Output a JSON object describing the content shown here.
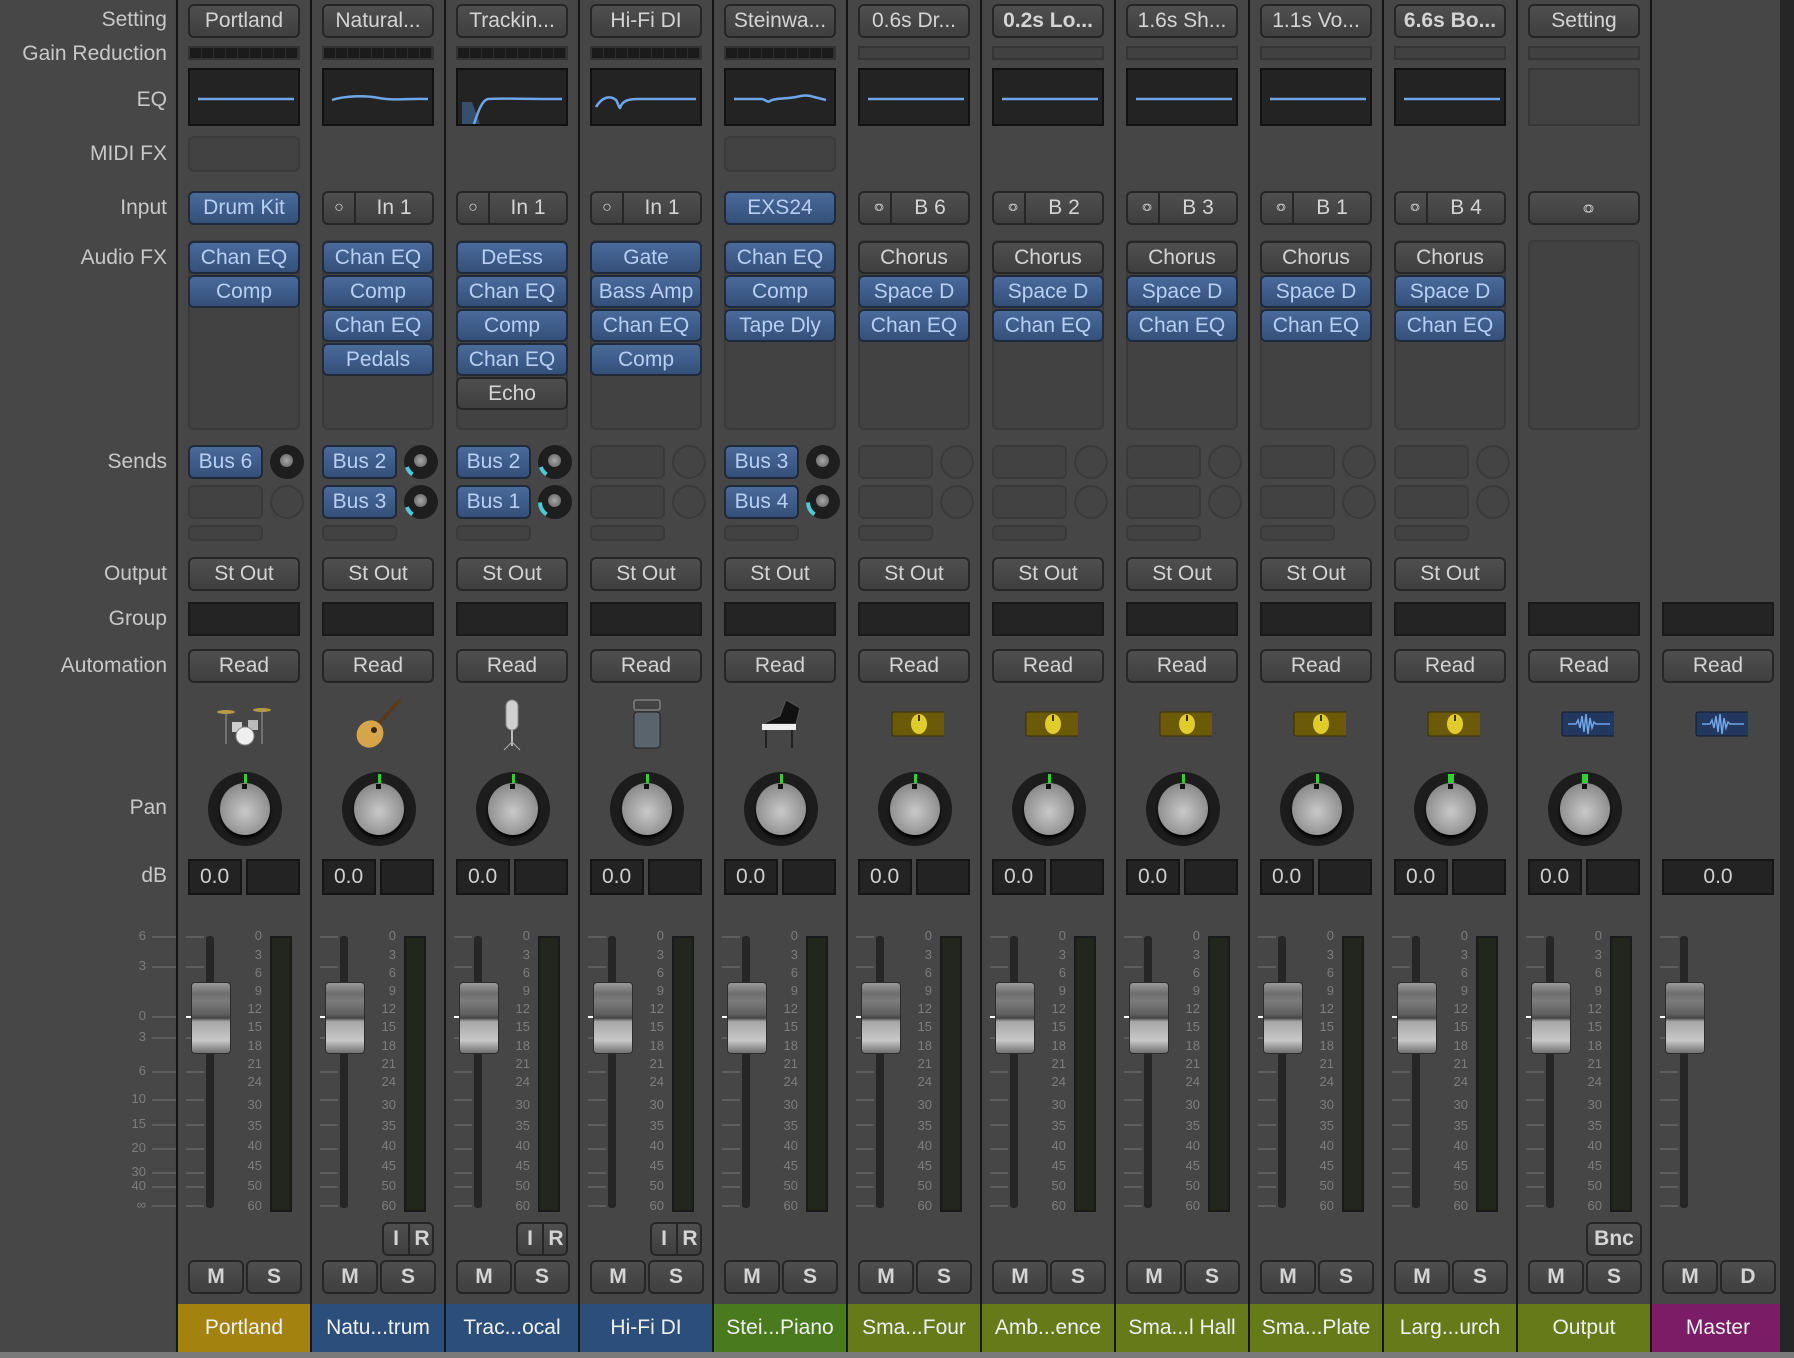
{
  "row_labels": {
    "setting": "Setting",
    "gain_reduction": "Gain Reduction",
    "eq": "EQ",
    "midi_fx": "MIDI FX",
    "input": "Input",
    "audio_fx": "Audio FX",
    "sends": "Sends",
    "output": "Output",
    "group": "Group",
    "automation": "Automation",
    "pan": "Pan",
    "db": "dB"
  },
  "fader_scale_left": [
    "6",
    "3",
    "0",
    "3",
    "6",
    "10",
    "15",
    "20",
    "30",
    "40",
    "∞"
  ],
  "meter_scale": [
    "0",
    "3",
    "6",
    "9",
    "12",
    "15",
    "18",
    "21",
    "24",
    "30",
    "35",
    "40",
    "45",
    "50",
    "60"
  ],
  "colors": {
    "track_yellow": "#a3820f",
    "track_blue": "#2c4e7a",
    "track_green": "#4a7a1e",
    "aux_olive": "#667a1a",
    "master_purple": "#7a1c66",
    "plugin_blue": "#3f5f8f",
    "pan_indicator": "#2fd12f",
    "send_arc": "#4fc8d8",
    "eq_curve": "#6ea6e8"
  },
  "strips": [
    {
      "setting": "Portland",
      "setting_bold": false,
      "gr": true,
      "eq": "flat",
      "midi_fx": true,
      "input": {
        "type": "instrument",
        "label": "Drum Kit"
      },
      "audio_fx": [
        {
          "label": "Chan EQ",
          "active": true
        },
        {
          "label": "Comp",
          "active": true
        }
      ],
      "sends": [
        {
          "label": "Bus 6",
          "level": 0
        }
      ],
      "send_slots": 2,
      "output": "St Out",
      "automation": "Read",
      "icon": "drum-kit-icon",
      "pan_wide": false,
      "volume": "0.0",
      "peak": "",
      "ir": false,
      "bnc": false,
      "mute": "M",
      "solo": "S",
      "name": "Portland",
      "color": "#a3820f"
    },
    {
      "setting": "Natural...",
      "setting_bold": false,
      "gr": true,
      "eq": "gentle",
      "midi_fx": false,
      "input": {
        "type": "mono",
        "label": "In 1"
      },
      "audio_fx": [
        {
          "label": "Chan EQ",
          "active": true
        },
        {
          "label": "Comp",
          "active": true
        },
        {
          "label": "Chan EQ",
          "active": true
        },
        {
          "label": "Pedals",
          "active": true
        }
      ],
      "sends": [
        {
          "label": "Bus 2",
          "level": 0.2
        },
        {
          "label": "Bus 3",
          "level": 0.2
        }
      ],
      "send_slots": 2,
      "output": "St Out",
      "automation": "Read",
      "icon": "acoustic-guitar-icon",
      "pan_wide": false,
      "volume": "0.0",
      "peak": "",
      "ir": true,
      "bnc": false,
      "mute": "M",
      "solo": "S",
      "name": "Natu...trum",
      "color": "#2c4e7a"
    },
    {
      "setting": "Trackin...",
      "setting_bold": false,
      "gr": true,
      "eq": "highpass",
      "midi_fx": false,
      "input": {
        "type": "mono",
        "label": "In 1"
      },
      "audio_fx": [
        {
          "label": "DeEss",
          "active": true
        },
        {
          "label": "Chan EQ",
          "active": true
        },
        {
          "label": "Comp",
          "active": true
        },
        {
          "label": "Chan EQ",
          "active": true
        },
        {
          "label": "Echo",
          "active": false
        }
      ],
      "sends": [
        {
          "label": "Bus 2",
          "level": 0.2
        },
        {
          "label": "Bus 1",
          "level": 0.3
        }
      ],
      "send_slots": 2,
      "output": "St Out",
      "automation": "Read",
      "icon": "microphone-icon",
      "pan_wide": false,
      "volume": "0.0",
      "peak": "",
      "ir": true,
      "bnc": false,
      "mute": "M",
      "solo": "S",
      "name": "Trac...ocal",
      "color": "#2c4e7a"
    },
    {
      "setting": "Hi-Fi DI",
      "setting_bold": false,
      "gr": true,
      "eq": "notch",
      "midi_fx": false,
      "input": {
        "type": "mono",
        "label": "In 1"
      },
      "audio_fx": [
        {
          "label": "Gate",
          "active": true
        },
        {
          "label": "Bass Amp",
          "active": true
        },
        {
          "label": "Chan EQ",
          "active": true
        },
        {
          "label": "Comp",
          "active": true
        }
      ],
      "sends": [],
      "send_slots": 2,
      "output": "St Out",
      "automation": "Read",
      "icon": "bass-amp-icon",
      "pan_wide": false,
      "volume": "0.0",
      "peak": "",
      "ir": true,
      "bnc": false,
      "mute": "M",
      "solo": "S",
      "name": "Hi-Fi DI",
      "color": "#2c4e7a"
    },
    {
      "setting": "Steinwa...",
      "setting_bold": false,
      "gr": true,
      "eq": "presence",
      "midi_fx": true,
      "input": {
        "type": "instrument",
        "label": "EXS24"
      },
      "audio_fx": [
        {
          "label": "Chan EQ",
          "active": true
        },
        {
          "label": "Comp",
          "active": true
        },
        {
          "label": "Tape Dly",
          "active": true
        }
      ],
      "sends": [
        {
          "label": "Bus 3",
          "level": 0
        },
        {
          "label": "Bus 4",
          "level": 0.3
        }
      ],
      "send_slots": 2,
      "output": "St Out",
      "automation": "Read",
      "icon": "grand-piano-icon",
      "pan_wide": false,
      "volume": "0.0",
      "peak": "",
      "ir": false,
      "bnc": false,
      "mute": "M",
      "solo": "S",
      "name": "Stei...Piano",
      "color": "#4a7a1e"
    },
    {
      "setting": "0.6s Dr...",
      "setting_bold": false,
      "gr": false,
      "eq": "flat",
      "midi_fx": false,
      "input": {
        "type": "bus",
        "label": "B 6"
      },
      "audio_fx": [
        {
          "label": "Chorus",
          "active": false
        },
        {
          "label": "Space D",
          "active": true
        },
        {
          "label": "Chan EQ",
          "active": true
        }
      ],
      "sends": [],
      "send_slots": 2,
      "output": "St Out",
      "automation": "Read",
      "icon": "aux-knob-icon",
      "pan_wide": false,
      "volume": "0.0",
      "peak": "",
      "ir": false,
      "bnc": false,
      "mute": "M",
      "solo": "S",
      "name": "Sma...Four",
      "color": "#667a1a"
    },
    {
      "setting": "0.2s Lo...",
      "setting_bold": true,
      "gr": false,
      "eq": "flat",
      "midi_fx": false,
      "input": {
        "type": "bus",
        "label": "B 2"
      },
      "audio_fx": [
        {
          "label": "Chorus",
          "active": false
        },
        {
          "label": "Space D",
          "active": true
        },
        {
          "label": "Chan EQ",
          "active": true
        }
      ],
      "sends": [],
      "send_slots": 2,
      "output": "St Out",
      "automation": "Read",
      "icon": "aux-knob-icon",
      "pan_wide": false,
      "volume": "0.0",
      "peak": "",
      "ir": false,
      "bnc": false,
      "mute": "M",
      "solo": "S",
      "name": "Amb...ence",
      "color": "#667a1a"
    },
    {
      "setting": "1.6s Sh...",
      "setting_bold": false,
      "gr": false,
      "eq": "flat",
      "midi_fx": false,
      "input": {
        "type": "bus",
        "label": "B 3"
      },
      "audio_fx": [
        {
          "label": "Chorus",
          "active": false
        },
        {
          "label": "Space D",
          "active": true
        },
        {
          "label": "Chan EQ",
          "active": true
        }
      ],
      "sends": [],
      "send_slots": 2,
      "output": "St Out",
      "automation": "Read",
      "icon": "aux-knob-icon",
      "pan_wide": false,
      "volume": "0.0",
      "peak": "",
      "ir": false,
      "bnc": false,
      "mute": "M",
      "solo": "S",
      "name": "Sma...l Hall",
      "color": "#667a1a"
    },
    {
      "setting": "1.1s Vo...",
      "setting_bold": false,
      "gr": false,
      "eq": "flat",
      "midi_fx": false,
      "input": {
        "type": "bus",
        "label": "B 1"
      },
      "audio_fx": [
        {
          "label": "Chorus",
          "active": false
        },
        {
          "label": "Space D",
          "active": true
        },
        {
          "label": "Chan EQ",
          "active": true
        }
      ],
      "sends": [],
      "send_slots": 2,
      "output": "St Out",
      "automation": "Read",
      "icon": "aux-knob-icon",
      "pan_wide": false,
      "volume": "0.0",
      "peak": "",
      "ir": false,
      "bnc": false,
      "mute": "M",
      "solo": "S",
      "name": "Sma...Plate",
      "color": "#667a1a"
    },
    {
      "setting": "6.6s Bo...",
      "setting_bold": true,
      "gr": false,
      "eq": "flat",
      "midi_fx": false,
      "input": {
        "type": "bus",
        "label": "B 4"
      },
      "audio_fx": [
        {
          "label": "Chorus",
          "active": false
        },
        {
          "label": "Space D",
          "active": true
        },
        {
          "label": "Chan EQ",
          "active": true
        }
      ],
      "sends": [],
      "send_slots": 2,
      "output": "St Out",
      "automation": "Read",
      "icon": "aux-knob-icon",
      "pan_wide": true,
      "volume": "0.0",
      "peak": "",
      "ir": false,
      "bnc": false,
      "mute": "M",
      "solo": "S",
      "name": "Larg...urch",
      "color": "#667a1a"
    },
    {
      "setting": "Setting",
      "setting_bold": false,
      "gr": false,
      "eq": "empty",
      "midi_fx": false,
      "input": {
        "type": "stereo-only",
        "label": ""
      },
      "audio_fx": [],
      "sends": [],
      "send_slots": 0,
      "output": "",
      "automation": "Read",
      "icon": "waveform-icon",
      "pan_wide": true,
      "volume": "0.0",
      "peak": "",
      "ir": false,
      "bnc": true,
      "bnc_label": "Bnc",
      "mute": "M",
      "solo": "S",
      "name": "Output",
      "color": "#667a1a"
    }
  ],
  "master": {
    "automation": "Read",
    "icon": "waveform-icon",
    "volume": "0.0",
    "mute": "M",
    "dim": "D",
    "name": "Master",
    "color": "#7a1c66"
  }
}
